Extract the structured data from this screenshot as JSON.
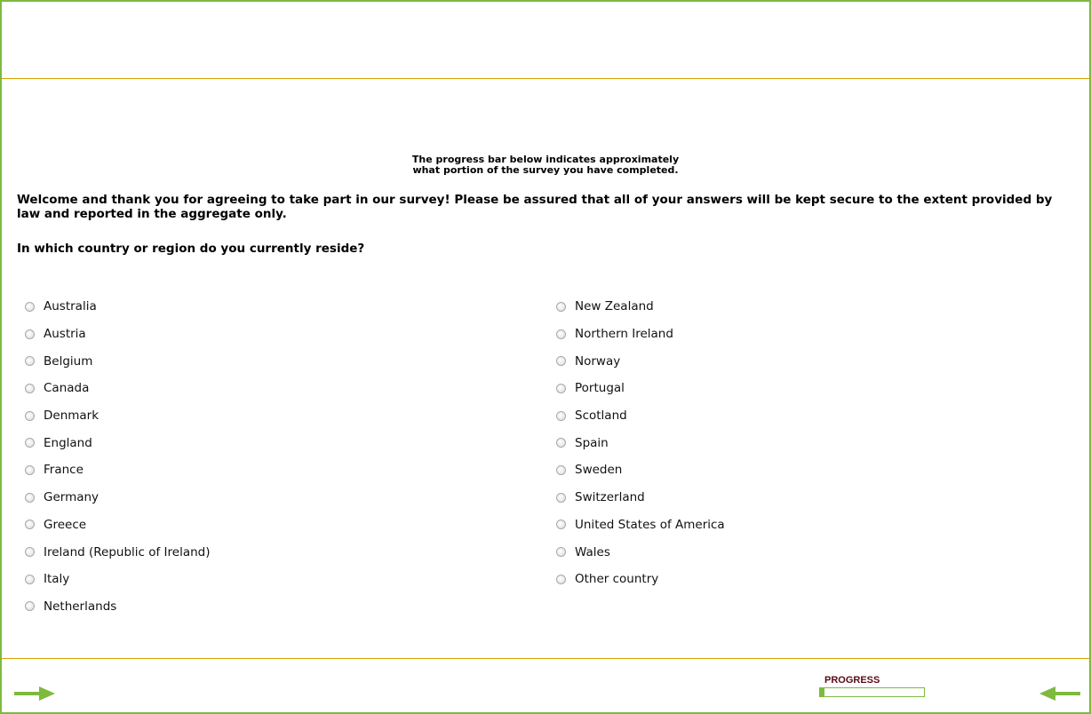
{
  "intro": {
    "progress_note_line1": "The progress bar below indicates approximately",
    "progress_note_line2": "what portion of the survey you have completed.",
    "welcome": "Welcome and thank you for agreeing to take part in our survey! Please be assured that all of your answers will be kept secure to the extent provided by law and reported in the aggregate only.",
    "question": "In which country or region do you currently reside?"
  },
  "options_left": [
    "Australia",
    "Austria",
    "Belgium",
    "Canada",
    "Denmark",
    "England",
    "France",
    "Germany",
    "Greece",
    "Ireland (Republic of Ireland)",
    "Italy",
    "Netherlands"
  ],
  "options_right": [
    "New Zealand",
    "Northern Ireland",
    "Norway",
    "Portugal",
    "Scotland",
    "Spain",
    "Sweden",
    "Switzerland",
    "United States of America",
    "Wales",
    "Other country"
  ],
  "footer": {
    "progress_label": "PROGRESS",
    "progress_value": 0.04,
    "next_icon": "arrow-right-icon",
    "back_icon": "arrow-left-icon"
  },
  "colors": {
    "accent_green": "#7dba3e",
    "divider_gold": "#d8a100",
    "progress_label": "#5a0a14"
  }
}
